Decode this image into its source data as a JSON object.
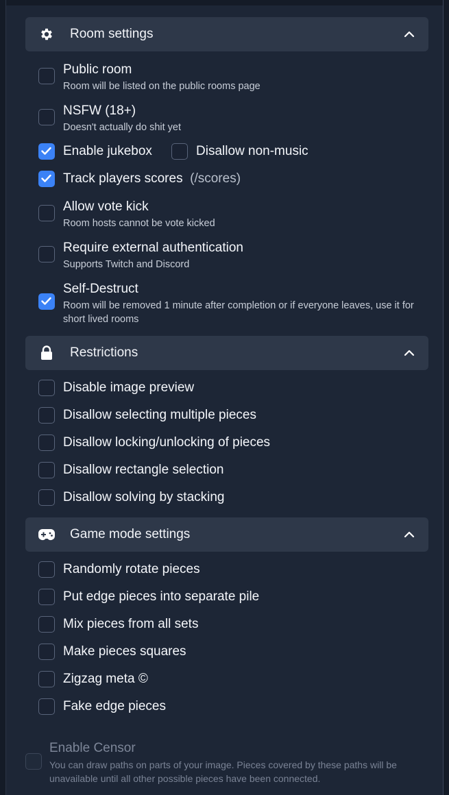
{
  "sections": {
    "room": {
      "title": "Room settings",
      "icon": "gear-icon",
      "options": {
        "public": {
          "label": "Public room",
          "desc": "Room will be listed on the public rooms page",
          "checked": false
        },
        "nsfw": {
          "label": "NSFW (18+)",
          "desc": "Doesn't actually do shit yet",
          "checked": false
        },
        "jukebox": {
          "label": "Enable jukebox",
          "checked": true
        },
        "nonmusic": {
          "label": "Disallow non-music",
          "checked": false
        },
        "scores": {
          "label": "Track players scores",
          "hint": "(/scores)",
          "checked": true
        },
        "votekick": {
          "label": "Allow vote kick",
          "desc": "Room hosts cannot be vote kicked",
          "checked": false
        },
        "auth": {
          "label": "Require external authentication",
          "desc": "Supports Twitch and Discord",
          "checked": false
        },
        "selfdestruct": {
          "label": "Self-Destruct",
          "desc": "Room will be removed 1 minute after completion or if everyone leaves, use it for short lived rooms",
          "checked": true
        }
      }
    },
    "restrictions": {
      "title": "Restrictions",
      "icon": "lock-icon",
      "options": {
        "preview": {
          "label": "Disable image preview",
          "checked": false
        },
        "multi": {
          "label": "Disallow selecting multiple pieces",
          "checked": false
        },
        "locking": {
          "label": "Disallow locking/unlocking of pieces",
          "checked": false
        },
        "rect": {
          "label": "Disallow rectangle selection",
          "checked": false
        },
        "stacking": {
          "label": "Disallow solving by stacking",
          "checked": false
        }
      }
    },
    "gamemode": {
      "title": "Game mode settings",
      "icon": "gamepad-icon",
      "options": {
        "rotate": {
          "label": "Randomly rotate pieces",
          "checked": false
        },
        "edge": {
          "label": "Put edge pieces into separate pile",
          "checked": false
        },
        "mix": {
          "label": "Mix pieces from all sets",
          "checked": false
        },
        "squares": {
          "label": "Make pieces squares",
          "checked": false
        },
        "zigzag": {
          "label": "Zigzag meta ©",
          "checked": false
        },
        "fake": {
          "label": "Fake edge pieces",
          "checked": false
        }
      }
    }
  },
  "censor": {
    "label": "Enable Censor",
    "desc": "You can draw paths on parts of your image. Pieces covered by these paths will be unavailable until all other possible pieces have been connected.",
    "checked": false,
    "disabled": true
  },
  "colors": {
    "accent": "#3b82f6",
    "header_bg": "#2e3849",
    "page_bg": "#1d2636"
  }
}
